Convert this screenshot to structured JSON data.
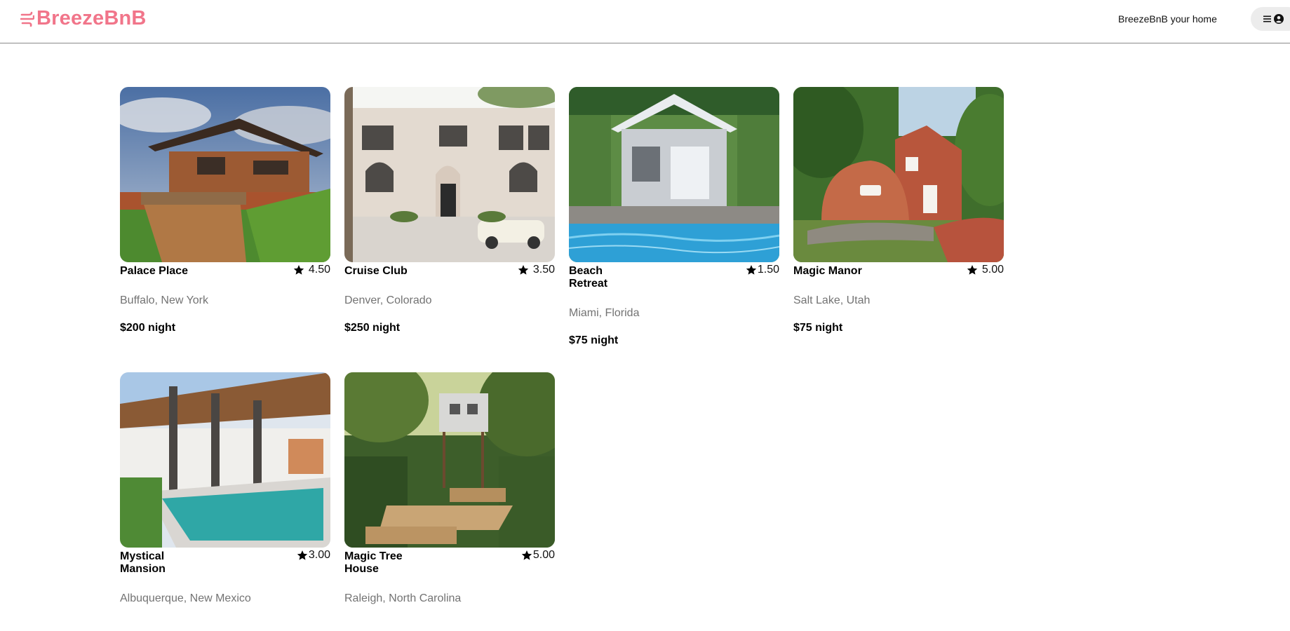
{
  "header": {
    "logo_text": "BreezeBnB",
    "tagline": "BreezeBnB your home",
    "menu_icon": "hamburger-icon",
    "user_icon": "user-circle-icon",
    "brand_color": "#f1758a"
  },
  "listings": [
    {
      "name": "Palace Place",
      "rating": "4.50",
      "location": "Buffalo, New York",
      "price": "$200 night",
      "image": "prairie-style-house-photo"
    },
    {
      "name": "Cruise Club",
      "rating": "3.50",
      "location": "Denver, Colorado",
      "price": "$250 night",
      "image": "white-mansion-with-vintage-car-photo"
    },
    {
      "name": "Beach Retreat",
      "rating": "1.50",
      "location": "Miami, Florida",
      "price": "$75 night",
      "image": "cottage-with-pool-photo"
    },
    {
      "name": "Magic Manor",
      "rating": "5.00",
      "location": "Salt Lake, Utah",
      "price": "$75 night",
      "image": "shoe-shaped-house-photo"
    },
    {
      "name": "Mystical Mansion",
      "rating": "3.00",
      "location": "Albuquerque, New Mexico",
      "price": "",
      "image": "modern-house-with-pool-photo"
    },
    {
      "name": "Magic Tree House",
      "rating": "5.00",
      "location": "Raleigh, North Carolina",
      "price": "",
      "image": "treehouse-with-deck-photo"
    }
  ]
}
